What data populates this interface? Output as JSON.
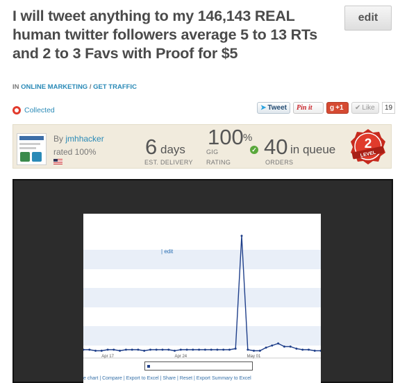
{
  "gig": {
    "title": "I will tweet anything to my 146,143 REAL human twitter followers average 5 to 13 RTs and 2 to 3 Favs with Proof for $5",
    "edit_label": "edit"
  },
  "breadcrumb": {
    "prefix": "IN",
    "category": "ONLINE MARKETING",
    "separator": "/",
    "subcategory": "GET TRAFFIC"
  },
  "collected": {
    "label": "Collected",
    "icon": "heart-icon"
  },
  "social": {
    "tweet_label": "Tweet",
    "pinit_label": "Pin it",
    "gplus_label": "+1",
    "like_label": "Like",
    "like_count": "19"
  },
  "seller": {
    "by_prefix": "By",
    "username": "jmhhacker",
    "rated": "rated 100%",
    "country_flag": "us-flag-icon"
  },
  "stats": {
    "delivery_value": "6",
    "delivery_unit": "days",
    "delivery_label": "EST. DELIVERY",
    "rating_value": "100",
    "rating_sign": "%",
    "rating_label1": "GIG",
    "rating_label2": "RATING",
    "queue_value": "40",
    "queue_unit": "in queue",
    "queue_label": "ORDERS",
    "level_number": "2",
    "level_text": "LEVEL"
  },
  "media": {
    "chart_edit": "edit",
    "x_ticks": [
      "Apr 17",
      "Apr 24",
      "May 01"
    ],
    "toolbar": "e chart  |  Compare  |  Export to Excel  |  Share  |  Reset  |  Export Summary to Excel"
  },
  "chart_data": {
    "type": "line",
    "x": [
      0,
      1,
      2,
      3,
      4,
      5,
      6,
      7,
      8,
      9,
      10,
      11,
      12,
      13,
      14,
      15,
      16,
      17,
      18,
      19,
      20,
      21,
      22,
      23,
      24,
      25,
      26,
      27,
      28,
      29,
      30,
      31,
      32,
      33,
      34,
      35,
      36,
      37,
      38,
      39
    ],
    "values": [
      1,
      1,
      0.9,
      0.9,
      1,
      1,
      0.9,
      1,
      1,
      1,
      0.9,
      1,
      1,
      1,
      1,
      0.9,
      1,
      1,
      1,
      1,
      1,
      1,
      1,
      1,
      1,
      1.1,
      12,
      1,
      0.9,
      0.9,
      1.2,
      1.4,
      1.6,
      1.3,
      1.3,
      1.1,
      1,
      1,
      0.9,
      0.9
    ],
    "x_tick_labels": [
      "Apr 17",
      "Apr 24",
      "May 01"
    ],
    "colors": {
      "line": "#1f3f8a",
      "band": "#e9eff8"
    }
  },
  "colors": {
    "link": "#2a8ab7",
    "panel": "#f1ebdd",
    "level_badge": "#c62a1e"
  }
}
